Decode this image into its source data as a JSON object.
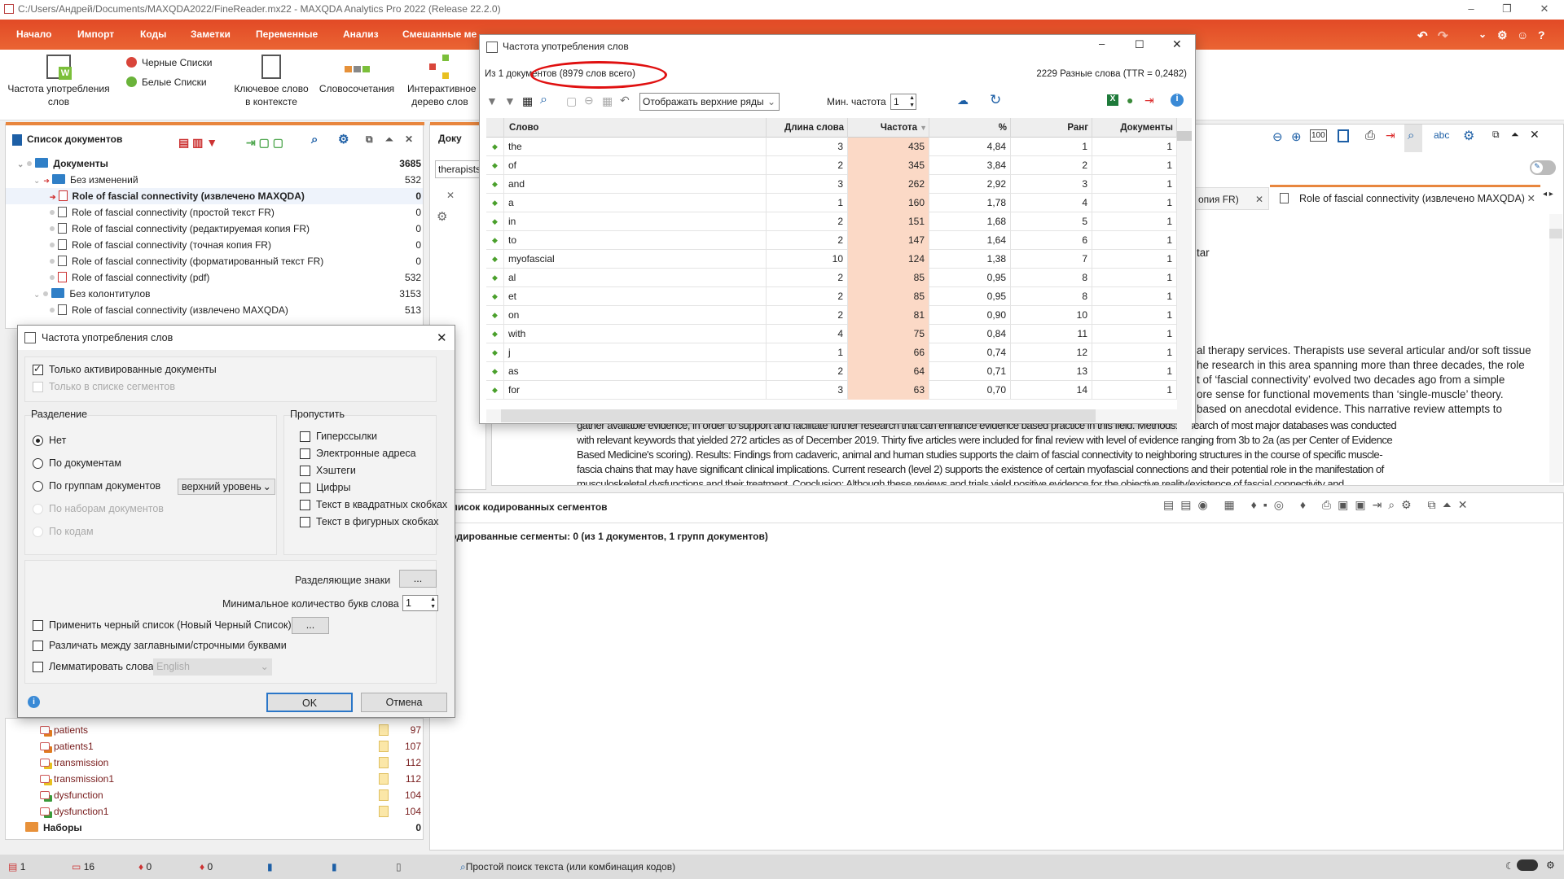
{
  "window": {
    "title": "C:/Users/Андрей/Documents/MAXQDA2022/FineReader.mx22 - MAXQDA Analytics Pro 2022 (Release 22.2.0)",
    "minimize": "–",
    "restore": "❐",
    "close": "✕"
  },
  "ribbon": {
    "tabs": [
      "Начало",
      "Импорт",
      "Коды",
      "Заметки",
      "Переменные",
      "Анализ",
      "Смешанные ме"
    ],
    "buttons": {
      "word_freq": "Частота употребления слов",
      "blacklists": "Черные Списки",
      "whitelists": "Белые Списки",
      "kwic": "Ключевое слово в контексте",
      "combos": "Словосочетания",
      "word_tree": "Интерактивное дерево слов"
    }
  },
  "doc_list": {
    "title": "Список документов",
    "items": [
      {
        "label": "Документы",
        "count": "3685",
        "level": 0,
        "kind": "folder",
        "bold": true
      },
      {
        "label": "Без изменений",
        "count": "532",
        "level": 1,
        "kind": "folder"
      },
      {
        "label": "Role of fascial connectivity (извлечено MAXQDA)",
        "count": "0",
        "level": 2,
        "kind": "doc-active",
        "bold": true
      },
      {
        "label": "Role of fascial connectivity (простой текст FR)",
        "count": "0",
        "level": 2,
        "kind": "doc"
      },
      {
        "label": "Role of fascial connectivity (редактируемая копия FR)",
        "count": "0",
        "level": 2,
        "kind": "doc"
      },
      {
        "label": "Role of fascial connectivity (точная копия FR)",
        "count": "0",
        "level": 2,
        "kind": "doc"
      },
      {
        "label": "Role of fascial connectivity (форматированный текст FR)",
        "count": "0",
        "level": 2,
        "kind": "doc"
      },
      {
        "label": "Role of fascial connectivity (pdf)",
        "count": "532",
        "level": 2,
        "kind": "pdf"
      },
      {
        "label": "Без колонтитулов",
        "count": "3153",
        "level": 1,
        "kind": "folder"
      },
      {
        "label": "Role of fascial connectivity (извлечено MAXQDA)",
        "count": "513",
        "level": 2,
        "kind": "doc"
      }
    ]
  },
  "codes": {
    "items": [
      {
        "label": "patients",
        "count": "97",
        "color": "#e07b20"
      },
      {
        "label": "patients1",
        "count": "107",
        "color": "#e07b20"
      },
      {
        "label": "transmission",
        "count": "112",
        "color": "#e8c020"
      },
      {
        "label": "transmission1",
        "count": "112",
        "color": "#e8c020"
      },
      {
        "label": "dysfunction",
        "count": "104",
        "color": "#3a9a3a"
      },
      {
        "label": "dysfunction1",
        "count": "104",
        "color": "#3a9a3a"
      }
    ],
    "sets": {
      "label": "Наборы",
      "count": "0"
    }
  },
  "browser": {
    "title": "Доку",
    "search": "therapists"
  },
  "document": {
    "tabs": [
      {
        "label": "опия FR)"
      },
      {
        "label": "Role of fascial connectivity (извлечено MAXQDA)",
        "active": true
      }
    ],
    "fragments": [
      "tar",
      "al therapy services. Therapists use several articular and/or soft tissue",
      "he research in this area spanning more than three decades, the role",
      "t of  ‘fascial connectivity’ evolved two decades ago from a simple",
      "ore sense for functional  movements than ‘single-muscle’ theory.",
      "based on anecdotal evidence. This  narrative review attempts to"
    ],
    "lines": [
      "gather available evidence, in order to support and facilitate further research  that can enhance evidence based practice in this field.  Methods: A search of most major databases was conducted",
      "with relevant keywords that yielded 272  articles as of December 2019. Thirty five articles were included for final review with level of evidence  ranging from 3b to 2a (as per Center of Evidence",
      "Based Medicine's scoring).  Results: Findings from cadaveric, animal and human studies supports the claim of fascial connectivity to  neighboring structures in the course of specific muscle-",
      "fascia chains that may have significant clinical  implications. Current research (level 2) supports the existence of certain myofascial connections and  their potential role in the manifestation of",
      "musculoskeletal dysfunctions and their treatment.  Conclusion: Although these reviews and trials yield positive evidence for the objective reality/existence  of fascial connectivity and"
    ]
  },
  "segments": {
    "title": "Список кодированных сегментов",
    "summary": "Кодированные сегменты: 0 (из 1 документов, 1 групп документов)"
  },
  "freq": {
    "title": "Частота употребления слов",
    "summary": "Из 1 документов (8979 слов всего)",
    "ttr": "2229 Разные слова (TTR = 0,2482)",
    "display_select": "Отображать верхние ряды",
    "min_freq_label": "Мин. частота",
    "min_freq": "1",
    "columns": [
      "Слово",
      "Длина слова",
      "Частота",
      "%",
      "Ранг",
      "Документы"
    ],
    "rows": [
      [
        "the",
        "3",
        "435",
        "4,84",
        "1",
        "1"
      ],
      [
        "of",
        "2",
        "345",
        "3,84",
        "2",
        "1"
      ],
      [
        "and",
        "3",
        "262",
        "2,92",
        "3",
        "1"
      ],
      [
        "a",
        "1",
        "160",
        "1,78",
        "4",
        "1"
      ],
      [
        "in",
        "2",
        "151",
        "1,68",
        "5",
        "1"
      ],
      [
        "to",
        "2",
        "147",
        "1,64",
        "6",
        "1"
      ],
      [
        "myofascial",
        "10",
        "124",
        "1,38",
        "7",
        "1"
      ],
      [
        "al",
        "2",
        "85",
        "0,95",
        "8",
        "1"
      ],
      [
        "et",
        "2",
        "85",
        "0,95",
        "8",
        "1"
      ],
      [
        "on",
        "2",
        "81",
        "0,90",
        "10",
        "1"
      ],
      [
        "with",
        "4",
        "75",
        "0,84",
        "11",
        "1"
      ],
      [
        "j",
        "1",
        "66",
        "0,74",
        "12",
        "1"
      ],
      [
        "as",
        "2",
        "64",
        "0,71",
        "13",
        "1"
      ],
      [
        "for",
        "3",
        "63",
        "0,70",
        "14",
        "1"
      ]
    ],
    "highlight_color": "#fbd9c6",
    "annotation_color": "#e01010"
  },
  "dialog": {
    "title": "Частота употребления слов",
    "only_activated": "Только активированные документы",
    "only_segments": "Только в списке сегментов",
    "split_title": "Разделение",
    "split_options": [
      "Нет",
      "По документам",
      "По группам документов",
      "По наборам документов",
      "По кодам"
    ],
    "group_level": "верхний уровень",
    "skip_title": "Пропустить",
    "skip_options": [
      "Гиперссылки",
      "Электронные адреса",
      "Хэштеги",
      "Цифры",
      "Текст в квадратных скобках",
      "Текст в фигурных скобках"
    ],
    "separators_label": "Разделяющие знаки",
    "dots": "...",
    "min_letters_label": "Минимальное количество букв слова",
    "min_letters": "1",
    "blacklist": "Применить черный список (Новый Черный Список)",
    "case": "Различать между заглавными/строчными буквами",
    "lemmatize": "Лемматировать слова",
    "language": "English",
    "ok": "OK",
    "cancel": "Отмена"
  },
  "status": {
    "docs": "1",
    "codes": "16",
    "c1": "0",
    "c2": "0",
    "search": "Простой поиск текста (или комбинация кодов)"
  }
}
